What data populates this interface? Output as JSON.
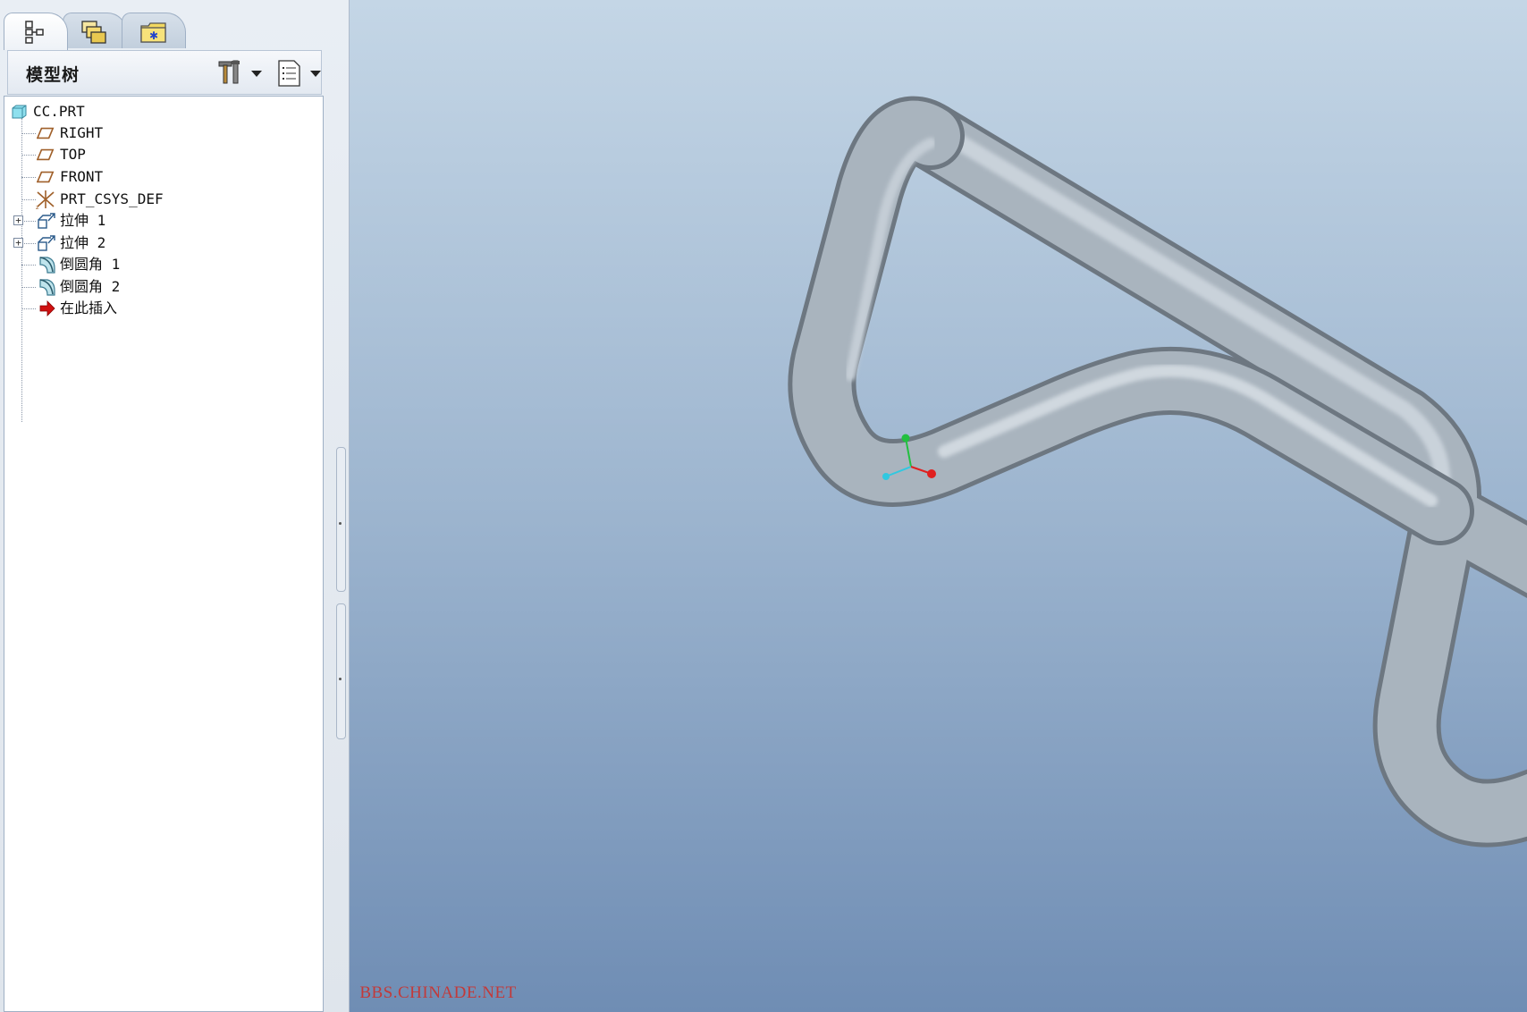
{
  "navigator": {
    "tabs": [
      {
        "name": "model-tree-tab",
        "icon": "model-tree-icon",
        "active": true
      },
      {
        "name": "layers-tab",
        "icon": "layers-icon",
        "active": false
      },
      {
        "name": "folder-browser-tab",
        "icon": "folder-icon",
        "active": false
      }
    ],
    "panel_title": "模型树",
    "settings_icon": "tools-settings-icon",
    "show_icon": "list-document-icon"
  },
  "tree": {
    "root": {
      "label": "CC.PRT",
      "icon": "part-icon"
    },
    "items": [
      {
        "label": "RIGHT",
        "icon": "datum-plane-icon",
        "expandable": false
      },
      {
        "label": "TOP",
        "icon": "datum-plane-icon",
        "expandable": false
      },
      {
        "label": "FRONT",
        "icon": "datum-plane-icon",
        "expandable": false
      },
      {
        "label": "PRT_CSYS_DEF",
        "icon": "coordinate-system-icon",
        "expandable": false
      },
      {
        "label": "拉伸 1",
        "icon": "extrude-icon",
        "expandable": true
      },
      {
        "label": "拉伸 2",
        "icon": "extrude-icon",
        "expandable": true
      },
      {
        "label": "倒圆角 1",
        "icon": "round-icon",
        "expandable": false
      },
      {
        "label": "倒圆角 2",
        "icon": "round-icon",
        "expandable": false
      },
      {
        "label": "在此插入",
        "icon": "insert-here-arrow-icon",
        "expandable": false
      }
    ]
  },
  "viewport": {
    "watermark": "BBS.CHINADE.NET",
    "model_color": "#a9b4be",
    "axis_colors": {
      "x": "#e02020",
      "y": "#22c040",
      "z": "#30c8e0"
    }
  }
}
